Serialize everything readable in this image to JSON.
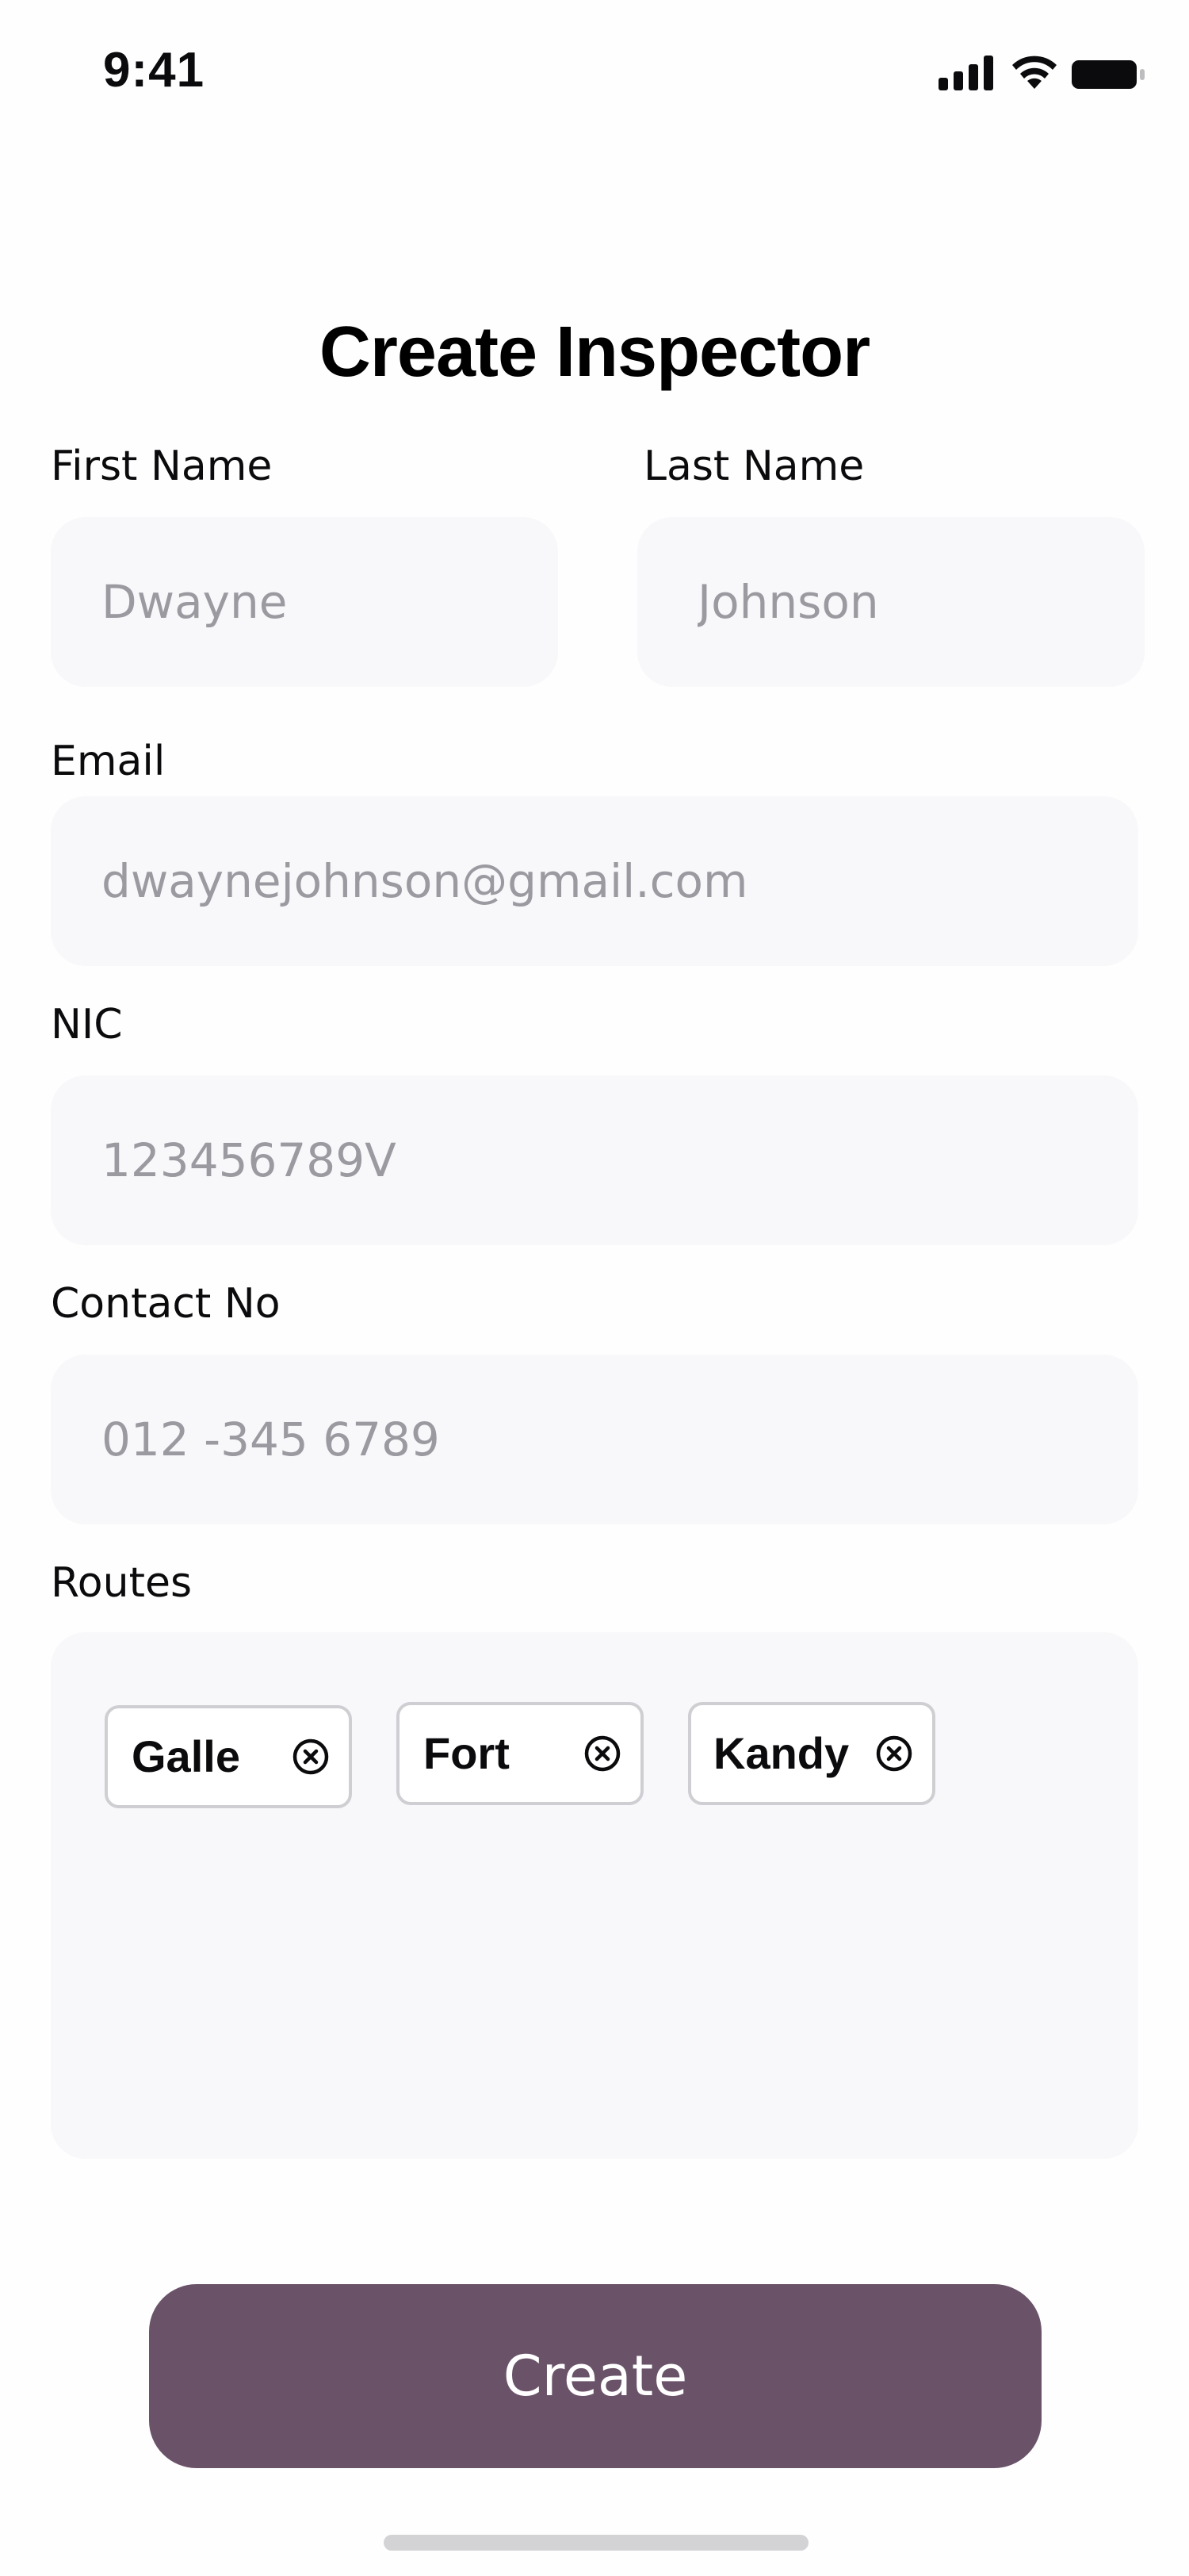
{
  "status_bar": {
    "time": "9:41",
    "icons": [
      "cellular-signal-icon",
      "wifi-icon",
      "battery-icon"
    ]
  },
  "page": {
    "title": "Create Inspector"
  },
  "form": {
    "first_name": {
      "label": "First Name",
      "placeholder": "Dwayne",
      "value": ""
    },
    "last_name": {
      "label": "Last Name",
      "placeholder": "Johnson",
      "value": ""
    },
    "email": {
      "label": "Email",
      "placeholder": "dwaynejohnson@gmail.com",
      "value": ""
    },
    "nic": {
      "label": "NIC",
      "placeholder": "123456789V",
      "value": ""
    },
    "contact_no": {
      "label": "Contact No",
      "placeholder": "012 -345 6789",
      "value": ""
    },
    "routes": {
      "label": "Routes",
      "chips": [
        {
          "label": "Galle",
          "remove_icon": "close-circle-icon"
        },
        {
          "label": "Fort",
          "remove_icon": "close-circle-icon"
        },
        {
          "label": "Kandy",
          "remove_icon": "close-circle-icon"
        }
      ]
    }
  },
  "actions": {
    "create_label": "Create"
  },
  "colors": {
    "primary_button": "#6a5369",
    "input_background": "#f8f8fa",
    "placeholder_text": "#9a9aa0",
    "chip_border": "#cfcfd3",
    "home_indicator": "#d3d3d6"
  }
}
